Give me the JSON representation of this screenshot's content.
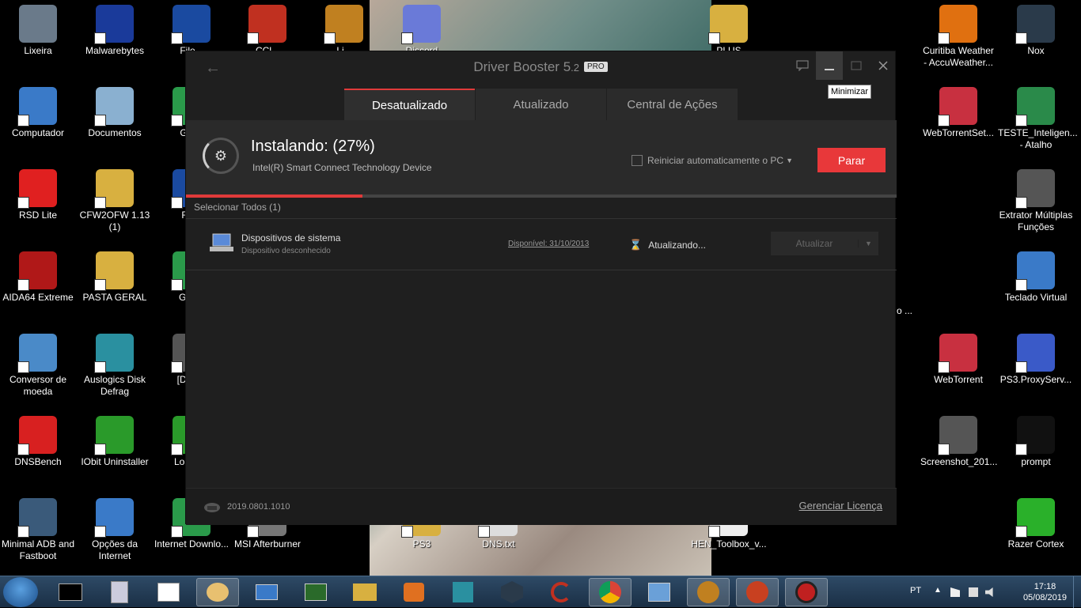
{
  "desktop": {
    "icons_left": [
      {
        "label": "Lixeira",
        "color": "#6a7a8a"
      },
      {
        "label": "Malwarebytes",
        "color": "#1a3a9a"
      },
      {
        "label": "File...",
        "color": "#1a4aa0"
      },
      {
        "label": "CCl...",
        "color": "#c03020"
      },
      {
        "label": "Li...",
        "color": "#c08020"
      },
      {
        "label": "Computador",
        "color": "#3a7ac8"
      },
      {
        "label": "Documentos",
        "color": "#8ab0d0"
      },
      {
        "label": "Goog",
        "color": "#2a9a4a"
      },
      {
        "label": "RSD Lite",
        "color": "#e02020"
      },
      {
        "label": "CFW2OFW 1.13 (1)",
        "color": "#d8b040"
      },
      {
        "label": "Filec",
        "color": "#1a4aa0"
      },
      {
        "label": "AIDA64 Extreme",
        "color": "#b01818"
      },
      {
        "label": "PASTA GERAL",
        "color": "#d8b040"
      },
      {
        "label": "Googl",
        "color": "#2a9a4a"
      },
      {
        "label": "Conversor de moeda",
        "color": "#4a8ac8"
      },
      {
        "label": "Auslogics Disk Defrag",
        "color": "#2a90a0"
      },
      {
        "label": "[Downl",
        "color": "#555"
      },
      {
        "label": "DNSBench",
        "color": "#d82020"
      },
      {
        "label": "IObit Uninstaller",
        "color": "#2a9a2a"
      },
      {
        "label": "Loade A",
        "color": "#2a9a2a"
      },
      {
        "label": "Minimal ADB and Fastboot",
        "color": "#3a5a7a"
      },
      {
        "label": "Opções da Internet",
        "color": "#3a7ac8"
      },
      {
        "label": "Internet Downlo...",
        "color": "#2a9a4a"
      },
      {
        "label": "MSI Afterburner",
        "color": "#777"
      }
    ],
    "icons_right": [
      {
        "label": "Curitiba Weather - AccuWeather...",
        "color": "#e07010"
      },
      {
        "label": "Nox",
        "color": "#2a3a4a"
      },
      {
        "label": "WebTorrentSet...",
        "color": "#c83040"
      },
      {
        "label": "TESTE_Inteligen... - Atalho",
        "color": "#2a8a4a"
      },
      {
        "label": "Extrator Múltiplas Funções",
        "color": "#555"
      },
      {
        "label": "Teclado Virtual",
        "color": "#3a7ac8"
      },
      {
        "label": "WebTorrent",
        "color": "#c83040"
      },
      {
        "label": "PS3.ProxyServ...",
        "color": "#3a5ac8"
      },
      {
        "label": "Screenshot_201...",
        "color": "#555"
      },
      {
        "label": "prompt",
        "color": "#111"
      },
      {
        "label": "Razer Cortex",
        "color": "#2ab02a"
      }
    ],
    "icons_middle": [
      {
        "label": "Discord",
        "color": "#6a7ad8"
      },
      {
        "label": "PLUS",
        "color": "#d8b040"
      },
      {
        "label": "PS3",
        "color": "#d8b040"
      },
      {
        "label": "DNS.txt",
        "color": "#ddd"
      },
      {
        "label": "HEN_Toolbox_v...",
        "color": "#eee"
      }
    ],
    "partial_text": "o ..."
  },
  "window": {
    "title": "Driver Booster 5",
    "version_suffix": ".2",
    "badge": "PRO",
    "back_icon": "←",
    "tabs": [
      {
        "label": "Desatualizado",
        "active": true
      },
      {
        "label": "Atualizado",
        "active": false
      },
      {
        "label": "Central de Ações",
        "active": false
      }
    ],
    "install": {
      "title": "Instalando: (27%)",
      "progress": 0.27,
      "device": "Intel(R) Smart Connect Technology Device",
      "checkbox_label": "Reiniciar automaticamente o PC",
      "stop_label": "Parar"
    },
    "select_all": "Selecionar Todos (1)",
    "row": {
      "name": "Dispositivos de sistema",
      "sub": "Dispositivo desconhecido",
      "available": "Disponível: 31/10/2013",
      "status": "Atualizando...",
      "button": "Atualizar"
    },
    "footer": {
      "version": "2019.0801.1010",
      "license": "Gerenciar Licença"
    },
    "tooltip": "Minimizar"
  },
  "taskbar": {
    "language": "PT",
    "time": "17:18",
    "date": "05/08/2019"
  }
}
